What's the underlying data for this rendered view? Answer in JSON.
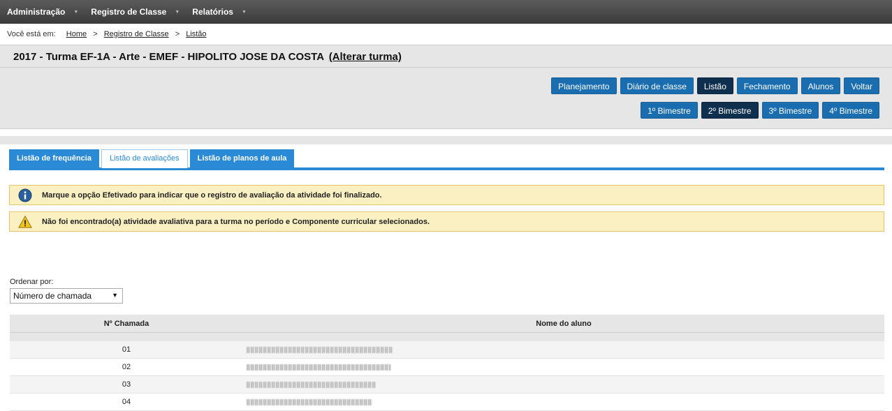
{
  "nav": {
    "items": [
      {
        "label": "Administração"
      },
      {
        "label": "Registro de Classe"
      },
      {
        "label": "Relatórios"
      }
    ]
  },
  "breadcrumb": {
    "prefix": "Você está em:",
    "items": [
      "Home",
      "Registro de Classe",
      "Listão"
    ],
    "separator": ">"
  },
  "header": {
    "title": "2017 - Turma EF-1A - Arte - EMEF - HIPOLITO JOSE DA COSTA",
    "change_link": "(Alterar turma)"
  },
  "toolbar": {
    "row1": [
      {
        "label": "Planejamento",
        "active": false
      },
      {
        "label": "Diário de classe",
        "active": false
      },
      {
        "label": "Listão",
        "active": true
      },
      {
        "label": "Fechamento",
        "active": false
      },
      {
        "label": "Alunos",
        "active": false
      },
      {
        "label": "Voltar",
        "active": false
      }
    ],
    "row2": [
      {
        "label": "1º Bimestre",
        "active": false
      },
      {
        "label": "2º Bimestre",
        "active": true
      },
      {
        "label": "3º Bimestre",
        "active": false
      },
      {
        "label": "4º Bimestre",
        "active": false
      }
    ]
  },
  "tabs": [
    {
      "label": "Listão de frequência",
      "selected": false
    },
    {
      "label": "Listão de avaliações",
      "selected": true
    },
    {
      "label": "Listão de planos de aula",
      "selected": false
    }
  ],
  "alerts": {
    "info": {
      "icon": "info-icon",
      "text": "Marque a opção Efetivado para indicar que o registro de avaliação da atividade foi finalizado."
    },
    "warning": {
      "icon": "warning-icon",
      "text": "Não foi encontrado(a) atividade avaliativa para a turma no período e Componente curricular selecionados."
    }
  },
  "order": {
    "label": "Ordenar por:",
    "selected": "Número de chamada"
  },
  "table": {
    "headers": [
      "Nº Chamada",
      "Nome do aluno"
    ],
    "rows": [
      {
        "number": "01"
      },
      {
        "number": "02"
      },
      {
        "number": "03"
      },
      {
        "number": "04"
      }
    ]
  },
  "colors": {
    "primary": "#1a6eb0",
    "active": "#0f2f4f",
    "tab": "#2a8ad6",
    "alert_bg": "#faf0c2"
  }
}
